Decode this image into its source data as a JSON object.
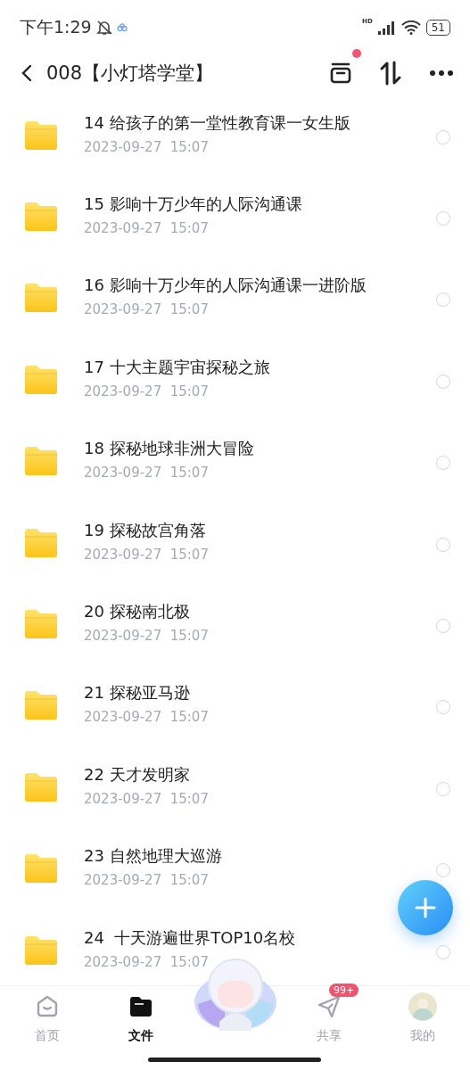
{
  "status_bar": {
    "time": "下午1:29",
    "network": "HD",
    "battery": "51"
  },
  "header": {
    "title": "008【小灯塔学堂】",
    "notification_dot": true
  },
  "files": [
    {
      "name": "14 给孩子的第一堂性教育课一女生版",
      "modified": "2023-09-27  15:07",
      "selected": false
    },
    {
      "name": "15 影响十万少年的人际沟通课",
      "modified": "2023-09-27  15:07",
      "selected": false
    },
    {
      "name": "16 影响十万少年的人际沟通课一进阶版",
      "modified": "2023-09-27  15:07",
      "selected": false
    },
    {
      "name": "17 十大主题宇宙探秘之旅",
      "modified": "2023-09-27  15:07",
      "selected": false
    },
    {
      "name": "18 探秘地球非洲大冒险",
      "modified": "2023-09-27  15:07",
      "selected": false
    },
    {
      "name": "19 探秘故宫角落",
      "modified": "2023-09-27  15:07",
      "selected": false
    },
    {
      "name": "20 探秘南北极",
      "modified": "2023-09-27  15:07",
      "selected": false
    },
    {
      "name": "21 探秘亚马逊",
      "modified": "2023-09-27  15:07",
      "selected": false
    },
    {
      "name": "22 天才发明家",
      "modified": "2023-09-27  15:07",
      "selected": false
    },
    {
      "name": "23 自然地理大巡游",
      "modified": "2023-09-27  15:07",
      "selected": false
    },
    {
      "name": "24  十天游遍世界TOP10名校",
      "modified": "2023-09-27  15:07",
      "selected": false
    }
  ],
  "nav": [
    {
      "kind": "home",
      "label": "首页",
      "selected": false
    },
    {
      "kind": "files",
      "label": "文件",
      "selected": true
    },
    {
      "kind": "mascot"
    },
    {
      "kind": "share",
      "label": "共享",
      "badge": "99+",
      "selected": false
    },
    {
      "kind": "profile",
      "label": "我的",
      "selected": false
    }
  ]
}
